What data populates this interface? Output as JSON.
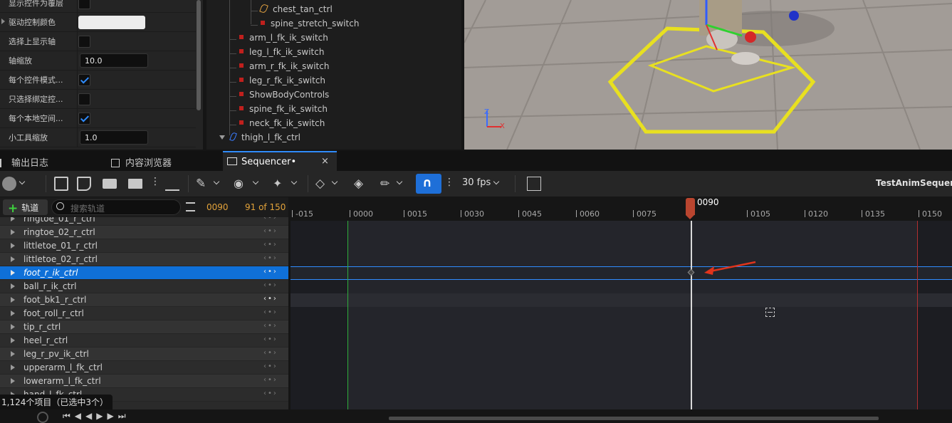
{
  "details": {
    "rows": [
      {
        "label": "显示控件为覆层",
        "type": "checkbox",
        "checked": false
      },
      {
        "label": "驱动控制颜色",
        "type": "color",
        "color": "#ececec"
      },
      {
        "label": "选择上显示轴",
        "type": "checkbox",
        "checked": false
      },
      {
        "label": "轴缩放",
        "type": "number",
        "value": "10.0"
      },
      {
        "label": "每个控件模式...",
        "type": "checkbox",
        "checked": true
      },
      {
        "label": "只选择绑定控...",
        "type": "checkbox",
        "checked": false
      },
      {
        "label": "每个本地空间...",
        "type": "checkbox",
        "checked": true
      },
      {
        "label": "小工具缩放",
        "type": "number",
        "value": "1.0"
      }
    ]
  },
  "outliner": {
    "items": [
      {
        "label": "chest_tan_ctrl",
        "icon": "curve-icon"
      },
      {
        "label": "spine_stretch_switch",
        "icon": "red-square-icon"
      },
      {
        "label": "arm_l_fk_ik_switch",
        "icon": "red-square-icon"
      },
      {
        "label": "leg_l_fk_ik_switch",
        "icon": "red-square-icon"
      },
      {
        "label": "arm_r_fk_ik_switch",
        "icon": "red-square-icon"
      },
      {
        "label": "leg_r_fk_ik_switch",
        "icon": "red-square-icon"
      },
      {
        "label": "ShowBodyControls",
        "icon": "red-square-icon"
      },
      {
        "label": "spine_fk_ik_switch",
        "icon": "red-square-icon"
      },
      {
        "label": "neck_fk_ik_switch",
        "icon": "red-square-icon"
      },
      {
        "label": "thigh_l_fk_ctrl",
        "icon": "blue-curve-icon"
      }
    ]
  },
  "tabs": [
    {
      "label": "输出日志",
      "active": false
    },
    {
      "label": "内容浏览器",
      "active": false
    },
    {
      "label": "Sequencer•",
      "active": true
    }
  ],
  "toolbar": {
    "fps": "30 fps",
    "sequence_name": "TestAnimSequence",
    "accent": "#1e6fd8"
  },
  "trackhead": {
    "add_track": "轨道",
    "search_placeholder": "搜索轨道",
    "current_frame": "0090",
    "frame_of": "91 of 150"
  },
  "tracks": [
    {
      "label": "ringtoe_01_r_ctrl",
      "selected": false
    },
    {
      "label": "ringtoe_02_r_ctrl",
      "selected": false
    },
    {
      "label": "littletoe_01_r_ctrl",
      "selected": false
    },
    {
      "label": "littletoe_02_r_ctrl",
      "selected": false
    },
    {
      "label": "foot_r_ik_ctrl",
      "selected": true
    },
    {
      "label": "ball_r_ik_ctrl",
      "selected": false
    },
    {
      "label": "foot_bk1_r_ctrl",
      "selected": false
    },
    {
      "label": "foot_roll_r_ctrl",
      "selected": false
    },
    {
      "label": "tip_r_ctrl",
      "selected": false
    },
    {
      "label": "heel_r_ctrl",
      "selected": false
    },
    {
      "label": "leg_r_pv_ik_ctrl",
      "selected": false
    },
    {
      "label": "upperarm_l_fk_ctrl",
      "selected": false
    },
    {
      "label": "lowerarm_l_fk_ctrl",
      "selected": false
    },
    {
      "label": "hand_l_fk_ctrl",
      "selected": false
    }
  ],
  "ruler": {
    "ticks": [
      "-015",
      "0000",
      "0015",
      "0030",
      "0045",
      "0060",
      "0075",
      "0105",
      "0120",
      "0135",
      "0150"
    ],
    "playhead": "0090"
  },
  "status": "1,124个项目（已选中3个）"
}
